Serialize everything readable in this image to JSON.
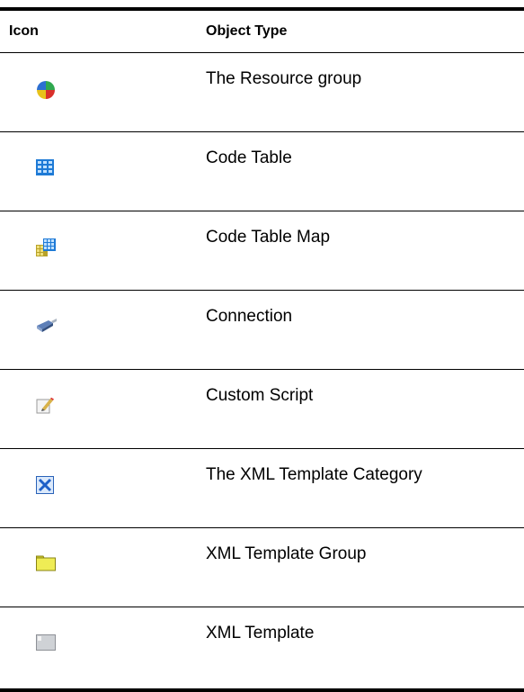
{
  "header": {
    "icon": "Icon",
    "type": "Object Type"
  },
  "rows": [
    {
      "icon": "resource-group-icon",
      "label": "The Resource group"
    },
    {
      "icon": "code-table-icon",
      "label": "Code Table"
    },
    {
      "icon": "code-table-map-icon",
      "label": "Code Table Map"
    },
    {
      "icon": "connection-icon",
      "label": "Connection"
    },
    {
      "icon": "custom-script-icon",
      "label": "Custom Script"
    },
    {
      "icon": "xml-template-category-icon",
      "label": "The XML Template Category"
    },
    {
      "icon": "xml-template-group-icon",
      "label": "XML Template Group"
    },
    {
      "icon": "xml-template-icon",
      "label": "XML Template"
    }
  ]
}
